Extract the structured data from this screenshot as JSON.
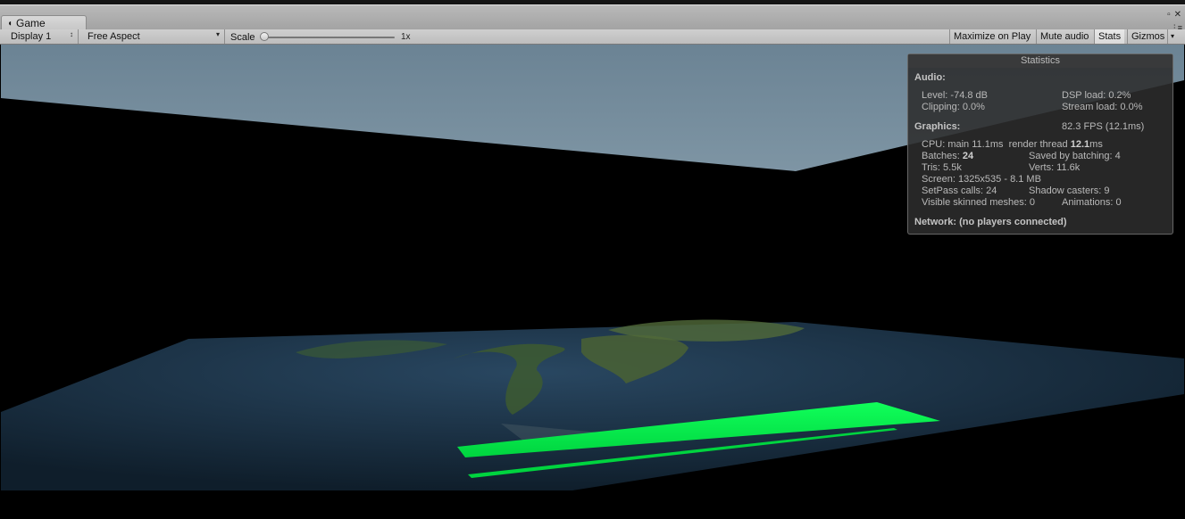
{
  "window": {
    "tab_title": "Game",
    "maximize_icon": "▫",
    "close_icon": "✕",
    "menu_icon": "⋮≡"
  },
  "toolbar": {
    "display_select": "Display 1",
    "aspect_select": "Free Aspect",
    "scale_label": "Scale",
    "scale_value": "1x",
    "scale_level": 0.0,
    "maximize_on_play": "Maximize on Play",
    "mute_audio": "Mute audio",
    "stats": "Stats",
    "gizmos": "Gizmos"
  },
  "stats": {
    "title": "Statistics",
    "audio_heading": "Audio:",
    "level": "Level: -74.8 dB",
    "dsp_load": "DSP load: 0.2%",
    "clipping": "Clipping: 0.0%",
    "stream_load": "Stream load: 0.0%",
    "graphics_heading": "Graphics:",
    "fps": "82.3 FPS (12.1ms)",
    "cpu_main": "CPU: main 11.1ms",
    "render_thread_label": "render thread",
    "render_thread_value": "12.1",
    "render_thread_unit": "ms",
    "batches_label": "Batches:",
    "batches_value": "24",
    "saved_by_batching": "Saved by batching: 4",
    "tris": "Tris: 5.5k",
    "verts": "Verts: 11.6k",
    "screen": "Screen: 1325x535 - 8.1 MB",
    "setpass_calls": "SetPass calls: 24",
    "shadow_casters": "Shadow casters: 9",
    "visible_skinned_meshes": "Visible skinned meshes: 0",
    "animations": "Animations: 0",
    "network": "Network: (no players connected)"
  },
  "colors": {
    "highlight_green": "#00f04a",
    "sky_top": "#6d8596",
    "sky_bottom": "#a9c0cc",
    "ocean": "#1c3247",
    "land": "#3f5e2c"
  }
}
